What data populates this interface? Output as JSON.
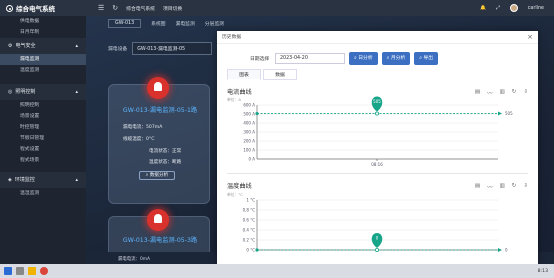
{
  "topbar": {
    "app_title": "综合电气系统",
    "links": [
      "综合电气系统",
      "项目切换"
    ],
    "user": "carline"
  },
  "sidebar": {
    "top_items": [
      "供电数据",
      "日月年制"
    ],
    "groups": [
      {
        "label": "电气安全",
        "items": [
          "漏电监测",
          "温度监测"
        ]
      },
      {
        "label": "照明控制",
        "items": [
          "照明控制",
          "场景设置",
          "时控管理",
          "节假日管理",
          "程式设置",
          "程式场景"
        ]
      },
      {
        "label": "环境监控",
        "items": [
          "温湿监测"
        ]
      }
    ],
    "active_item": "漏电监测"
  },
  "content": {
    "tabs": [
      "GW-013",
      "系统图",
      "漏电监测",
      "分层监测"
    ],
    "filter_label": "漏电设备",
    "filter_value": "GW-013-漏电监测-05",
    "cards": [
      {
        "title": "GW-013-漏电监测-05-1路",
        "leak_current": "漏电电流：507mA",
        "temperature": "线缆温度：0°C",
        "current_status": "电流状态：正常",
        "temp_status": "温度状态：断路",
        "btn": "数据分析"
      },
      {
        "title": "GW-013-漏电监测-05-3路"
      }
    ],
    "bottom_texts": [
      "漏电电流：0mA",
      "漏电电流：0mA",
      "漏电电流：0mA",
      "漏电电流：0mA"
    ]
  },
  "modal": {
    "title": "历史数据",
    "date_label": "日期选择",
    "date_value": "2023-04-20",
    "btn_day": "日分析",
    "btn_month": "月分析",
    "btn_export": "导出",
    "tabs": [
      "图表",
      "数据"
    ],
    "current_section": {
      "title": "电流曲线",
      "unit": "单位：A",
      "y_ticks": [
        "600 A",
        "500 A",
        "400 A",
        "300 A",
        "200 A",
        "100 A",
        "0 A"
      ],
      "x_label": "08:16",
      "marker_value": "505",
      "mark_line_value": "505"
    },
    "temp_section": {
      "title": "温度曲线",
      "unit": "单位：°C",
      "y_ticks": [
        "1 °C",
        "0.8 °C",
        "0.6 °C",
        "0.4 °C",
        "0.2 °C",
        "0 °C"
      ],
      "marker_value": "0",
      "mark_line_value": "0"
    }
  },
  "chart_data": [
    {
      "type": "line",
      "title": "电流曲线",
      "ylabel": "单位：A",
      "x": [
        "08:16"
      ],
      "series": [
        {
          "values": [
            505
          ]
        }
      ],
      "ylim": [
        0,
        600
      ],
      "grid": true
    },
    {
      "type": "line",
      "title": "温度曲线",
      "ylabel": "单位：°C",
      "x": [
        "08:16"
      ],
      "series": [
        {
          "values": [
            0
          ]
        }
      ],
      "ylim": [
        0,
        1
      ],
      "grid": true
    }
  ],
  "taskbar": {
    "time": "8:13"
  }
}
